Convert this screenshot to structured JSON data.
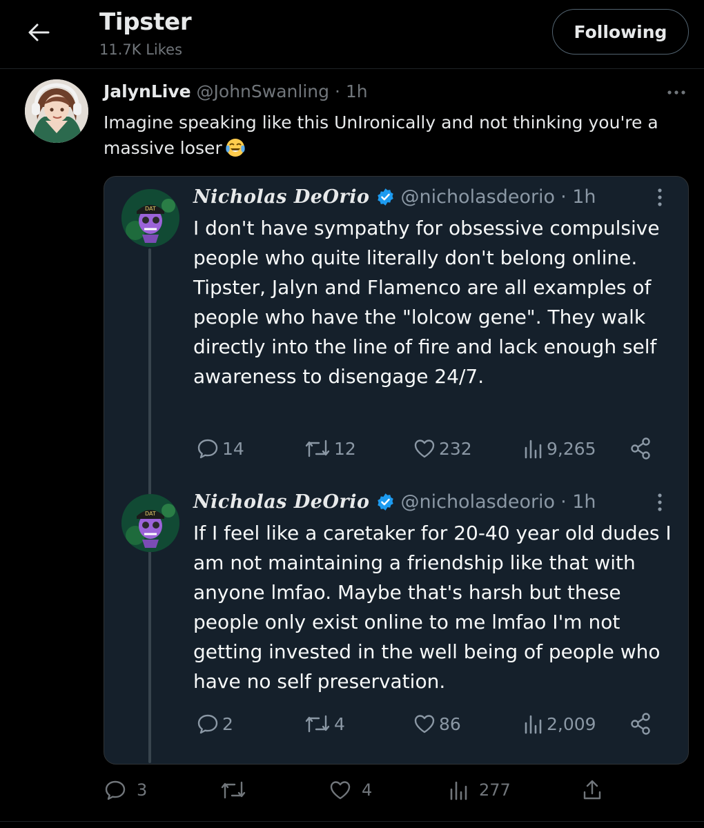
{
  "header": {
    "title": "Tipster",
    "subtitle": "11.7K Likes",
    "follow_label": "Following",
    "back_icon": "arrow-left-icon"
  },
  "post": {
    "name": "JalynLive",
    "handle": "@JohnSwanling",
    "time": "· 1h",
    "text": "Imagine speaking like this UnIronically and not thinking you're a massive loser",
    "emoji": "face-with-tears-of-joy-icon",
    "more_icon": "ellipsis-horizontal-icon",
    "actions": {
      "replies": "3",
      "reposts": "",
      "likes": "4",
      "views": "277"
    }
  },
  "quoted": [
    {
      "name": "Nicholas DeOrio",
      "handle": "@nicholasdeorio",
      "time": "· 1h",
      "text": "I don't have sympathy for obsessive compulsive people who quite literally don't belong online. Tipster, Jalyn and Flamenco are all examples of people who have the \"lolcow gene\". They walk directly into the line of fire and lack enough self awareness to disengage 24/7.",
      "replies": "14",
      "reposts": "12",
      "likes": "232",
      "views": "9,265"
    },
    {
      "name": "Nicholas DeOrio",
      "handle": "@nicholasdeorio",
      "time": "· 1h",
      "text": "If I feel like a caretaker for 20-40 year old dudes I am not maintaining a friendship like that with anyone lmfao. Maybe that's harsh but these people only exist online to me lmfao I'm not getting invested in the well being of people who have no self preservation.",
      "replies": "2",
      "reposts": "4",
      "likes": "86",
      "views": "2,009"
    }
  ],
  "colors": {
    "background": "#000000",
    "card": "#15202b",
    "text": "#e7e9ea",
    "muted": "#71767b",
    "verified": "#1d9bf0"
  }
}
